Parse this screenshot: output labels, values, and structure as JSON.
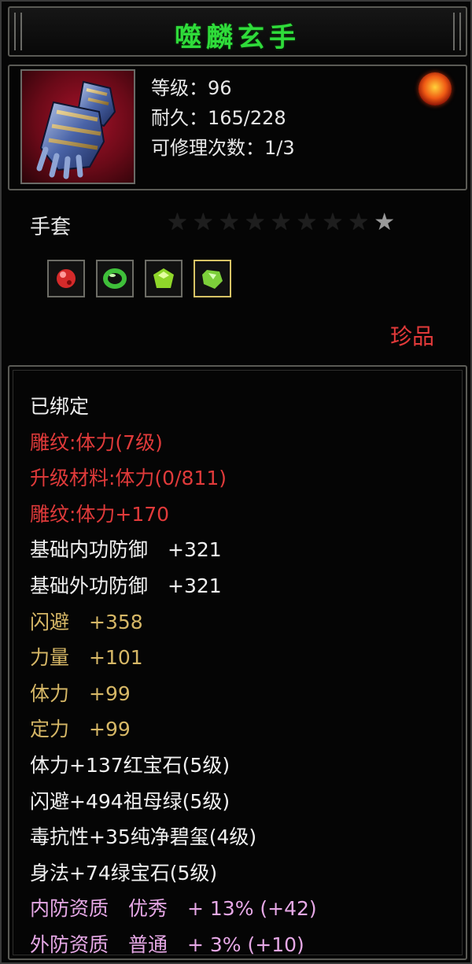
{
  "item": {
    "name": "噬麟玄手",
    "level_line": "等级：96",
    "durability_line": "耐久：165/228",
    "repair_line": "可修理次数：1/3",
    "type": "手套",
    "rarity": "珍品",
    "stars_total": 9,
    "stars_lit": 1
  },
  "colors": {
    "title": "#2fdc3a",
    "white": "#f0f0f0",
    "red": "#e03a3a",
    "gold": "#d6b766",
    "pink": "#e6a8e6"
  },
  "gems": [
    {
      "icon": "red-gem-icon",
      "color": "#d42a2a",
      "selected": false
    },
    {
      "icon": "emerald-ring-icon",
      "color": "#3fbf3a",
      "selected": false
    },
    {
      "icon": "green-gem-icon",
      "color": "#8fd62a",
      "selected": false
    },
    {
      "icon": "green-shard-icon",
      "color": "#7ccf3a",
      "selected": true
    }
  ],
  "attributes": [
    {
      "text": "已绑定",
      "tone": "white"
    },
    {
      "text": "雕纹:体力(7级)",
      "tone": "red"
    },
    {
      "text": "升级材料:体力(0/811)",
      "tone": "red"
    },
    {
      "text": "雕纹:体力+170",
      "tone": "red"
    },
    {
      "text": "基础内功防御　+321",
      "tone": "white"
    },
    {
      "text": "基础外功防御　+321",
      "tone": "white"
    },
    {
      "text": "闪避　+358",
      "tone": "gold"
    },
    {
      "text": "力量　+101",
      "tone": "gold"
    },
    {
      "text": "体力　+99",
      "tone": "gold"
    },
    {
      "text": "定力　+99",
      "tone": "gold"
    },
    {
      "text": "体力+137红宝石(5级)",
      "tone": "white"
    },
    {
      "text": "闪避+494祖母绿(5级)",
      "tone": "white"
    },
    {
      "text": "毒抗性+35纯净碧玺(4级)",
      "tone": "white"
    },
    {
      "text": "身法+74绿宝石(5级)",
      "tone": "white"
    },
    {
      "text": "内防资质　优秀　+ 13% (+42)",
      "tone": "pink"
    },
    {
      "text": "外防资质　普通　+ 3% (+10)",
      "tone": "pink"
    }
  ]
}
